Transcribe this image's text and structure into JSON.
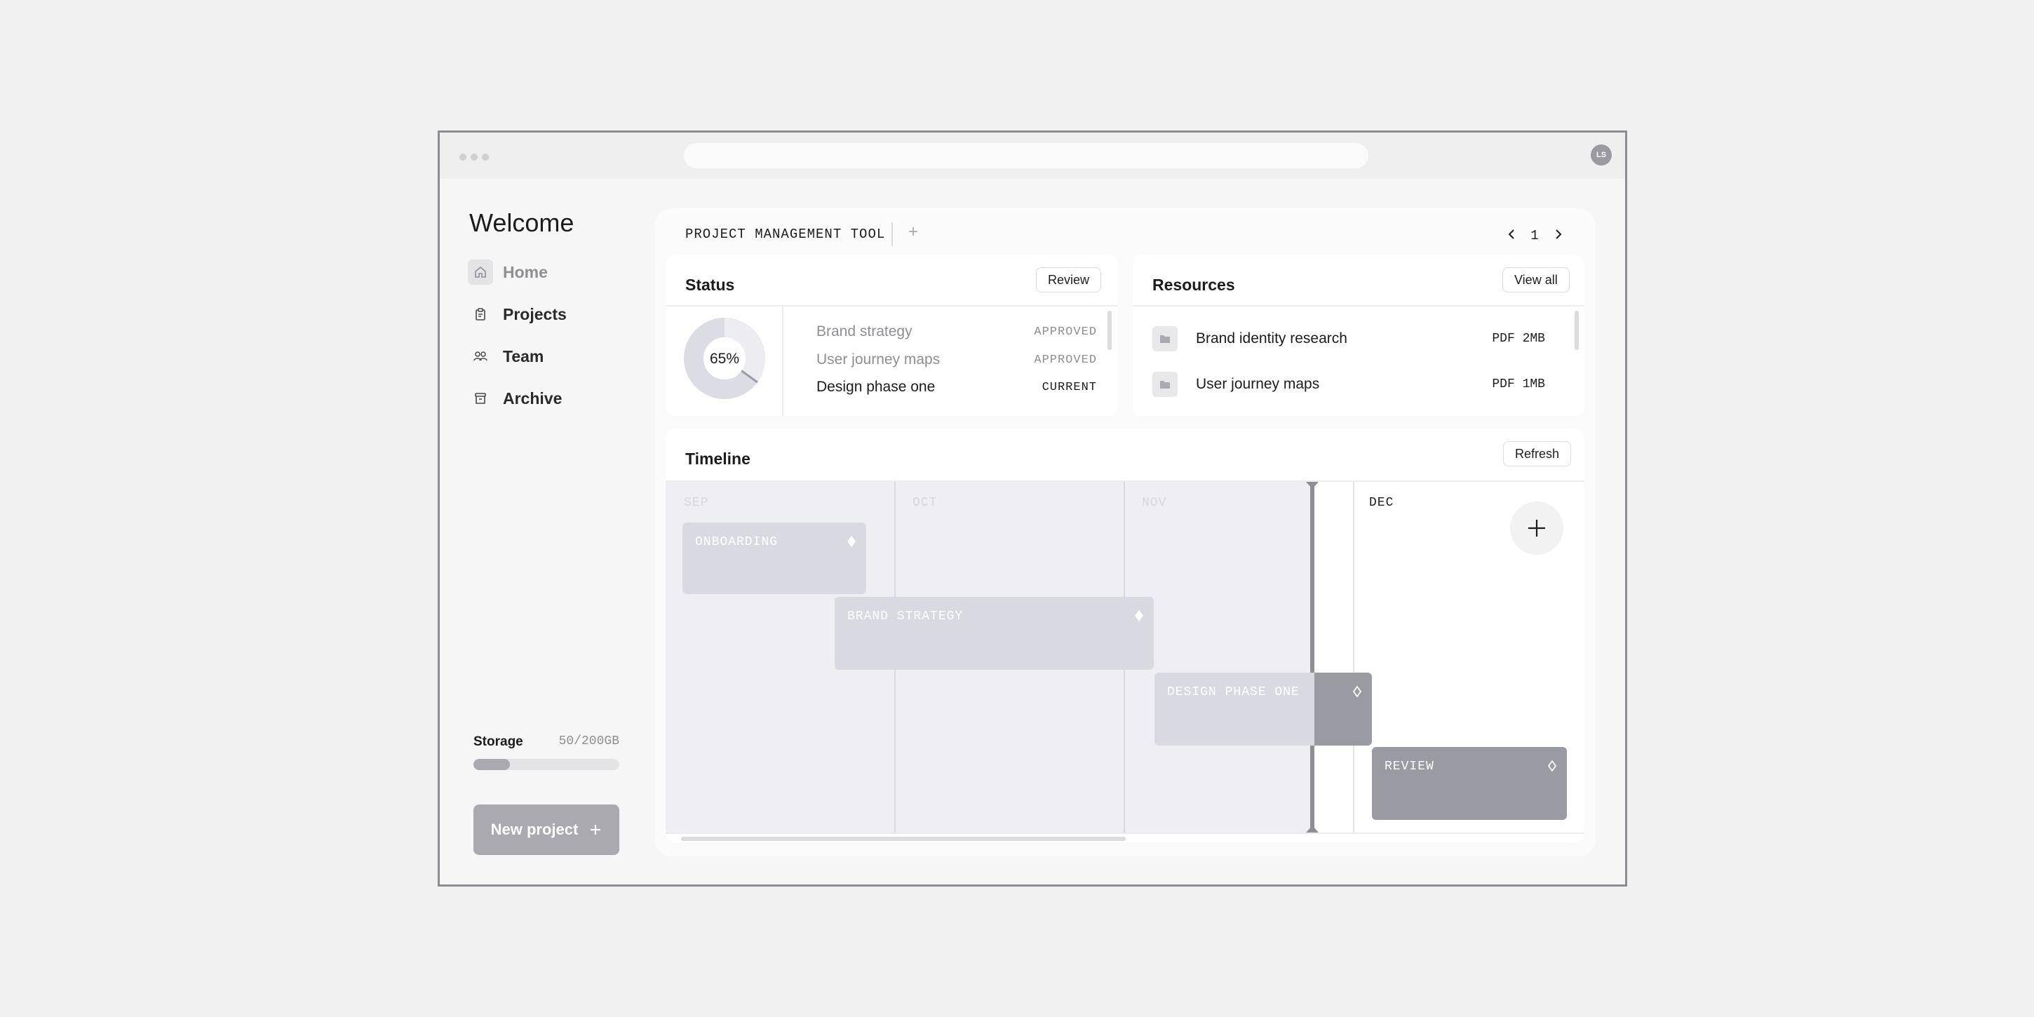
{
  "window": {
    "avatar_initials": "LS"
  },
  "sidebar": {
    "welcome": "Welcome",
    "items": [
      {
        "label": "Home",
        "icon": "home-icon",
        "active": true
      },
      {
        "label": "Projects",
        "icon": "clipboard-icon",
        "active": false
      },
      {
        "label": "Team",
        "icon": "team-icon",
        "active": false
      },
      {
        "label": "Archive",
        "icon": "archive-icon",
        "active": false
      }
    ],
    "storage": {
      "label": "Storage",
      "value": "50/200GB",
      "used_fraction": 0.25
    },
    "new_project_label": "New project"
  },
  "header": {
    "tab_title": "PROJECT MANAGEMENT TOOL",
    "tab_add": "+",
    "page_number": "1"
  },
  "status": {
    "title": "Status",
    "button": "Review",
    "progress_label": "65%",
    "progress_fraction": 0.65,
    "items": [
      {
        "name": "Brand strategy",
        "state": "APPROVED"
      },
      {
        "name": "User journey maps",
        "state": "APPROVED"
      },
      {
        "name": "Design phase one",
        "state": "CURRENT"
      }
    ]
  },
  "resources": {
    "title": "Resources",
    "button": "View all",
    "items": [
      {
        "name": "Brand identity research",
        "meta": "PDF 2MB"
      },
      {
        "name": "User journey maps",
        "meta": "PDF 1MB"
      }
    ]
  },
  "timeline": {
    "title": "Timeline",
    "button": "Refresh",
    "months": [
      "SEP",
      "OCT",
      "NOV",
      "DEC"
    ],
    "tasks": [
      {
        "label": "ONBOARDING"
      },
      {
        "label": "BRAND STRATEGY"
      },
      {
        "label": "DESIGN PHASE ONE"
      },
      {
        "label": "REVIEW"
      }
    ]
  },
  "colors": {
    "accent_gray": "#a9a9af",
    "past_task": "#d9d9e1",
    "current_task": "#9a9aa2"
  }
}
